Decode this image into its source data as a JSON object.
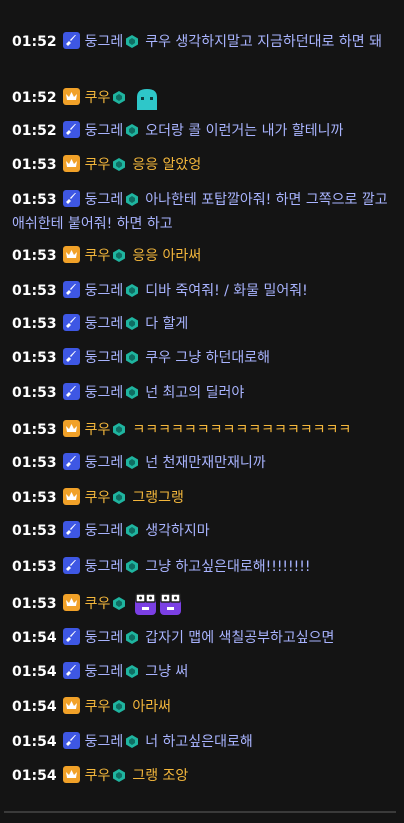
{
  "messages": [
    {
      "time": "01:52",
      "role": "sword",
      "name": "둥그레",
      "text": "쿠우 생각하지말고 지금하던대로 하면 돼",
      "top": 0
    },
    {
      "time": "01:52",
      "role": "crown",
      "name": "쿠우",
      "text": "",
      "emote": "ghost-emote"
    },
    {
      "time": "01:52",
      "role": "sword",
      "name": "둥그레",
      "text": "오더랑 콜 이런거는 내가 할테니까"
    },
    {
      "time": "01:53",
      "role": "crown",
      "name": "쿠우",
      "text": "응응 알았엉"
    },
    {
      "time": "01:53",
      "role": "sword",
      "name": "둥그레",
      "text": "아나한테 포탑깔아줘! 하면 그쪽으로 깔고 애쉬한테 붙어줘! 하면 하고"
    },
    {
      "time": "01:53",
      "role": "crown",
      "name": "쿠우",
      "text": "응응 아라써"
    },
    {
      "time": "01:53",
      "role": "sword",
      "name": "둥그레",
      "text": "디바 죽여줘! / 화물 밀어줘!"
    },
    {
      "time": "01:53",
      "role": "sword",
      "name": "둥그레",
      "text": "다 할게"
    },
    {
      "time": "01:53",
      "role": "sword",
      "name": "둥그레",
      "text": "쿠우 그냥 하던대로해"
    },
    {
      "time": "01:53",
      "role": "sword",
      "name": "둥그레",
      "text": "넌 최고의 딜러야"
    },
    {
      "time": "01:53",
      "role": "crown",
      "name": "쿠우",
      "text": "ㅋㅋㅋㅋㅋㅋㅋㅋㅋㅋㅋㅋㅋㅋㅋㅋㅋ"
    },
    {
      "time": "01:53",
      "role": "sword",
      "name": "둥그레",
      "text": "넌 천재만재만재니까"
    },
    {
      "time": "01:53",
      "role": "crown",
      "name": "쿠우",
      "text": "그랭그랭"
    },
    {
      "time": "01:53",
      "role": "sword",
      "name": "둥그레",
      "text": "생각하지마"
    },
    {
      "time": "01:53",
      "role": "sword",
      "name": "둥그레",
      "text": "그냥 하고싶은대로해!!!!!!!!"
    },
    {
      "time": "01:53",
      "role": "crown",
      "name": "쿠우",
      "text": "",
      "emote": "nerd-emote"
    },
    {
      "time": "01:54",
      "role": "sword",
      "name": "둥그레",
      "text": "갑자기 맵에 색칠공부하고싶으면"
    },
    {
      "time": "01:54",
      "role": "sword",
      "name": "둥그레",
      "text": "그냥 써"
    },
    {
      "time": "01:54",
      "role": "crown",
      "name": "쿠우",
      "text": "아라써"
    },
    {
      "time": "01:54",
      "role": "sword",
      "name": "둥그레",
      "text": "너 하고싶은대로해"
    },
    {
      "time": "01:54",
      "role": "crown",
      "name": "쿠우",
      "text": "그랭 조앙"
    }
  ],
  "colors": {
    "background": "#141414",
    "sword_badge": "#3e57e4",
    "crown_badge": "#f1a128",
    "blue_text": "#a9b4ff",
    "yellow_text": "#f4b73c",
    "gem": "#1fb5a0"
  },
  "icons": {
    "sword_badge": "sword-icon",
    "crown_badge": "crown-icon",
    "gem": "gem-icon"
  }
}
